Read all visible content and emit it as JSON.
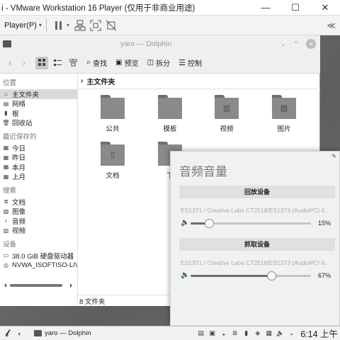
{
  "vmware": {
    "title": "i - VMware Workstation 16 Player (仅用于非商业用途)",
    "player_menu": "Player(P)",
    "collapse_glyph": "≪"
  },
  "dolphin": {
    "window_title": "yaro — Dolphin",
    "toolbar": {
      "search": "查找",
      "preview": "预览",
      "split": "拆分",
      "control": "控制"
    },
    "breadcrumb": "主文件夹",
    "sidebar": {
      "places_heading": "位置",
      "places": [
        "主文件夹",
        "网络",
        "根",
        "回收站"
      ],
      "recent_heading": "最近保存的",
      "recent": [
        "今日",
        "昨日",
        "本月",
        "上月"
      ],
      "search_heading": "搜索",
      "search": [
        "文档",
        "图像",
        "音频",
        "视频"
      ],
      "devices_heading": "设备",
      "devices": [
        "38.0 GiB 硬盘驱动器",
        "NVWA_ISOFTISO-LIVECD"
      ]
    },
    "files": [
      "公共",
      "模板",
      "视频",
      "图片",
      "文档",
      "下"
    ],
    "status": "8 文件夹"
  },
  "volume": {
    "title": "音频音量",
    "playback_heading": "回放设备",
    "playback_device": "ES1371 / Creative Labs CT2518/ES1373 (AudioPCI 6...",
    "playback_percent": "15%",
    "playback_level": 0.15,
    "capture_heading": "抓取设备",
    "capture_device": "ES1371 / Creative Labs CT2518/ES1373 (AudioPCI 6...",
    "capture_percent": "67%",
    "capture_level": 0.67
  },
  "taskbar": {
    "task_label": "yaro — Dolphin",
    "clock": "6:14 上午"
  }
}
